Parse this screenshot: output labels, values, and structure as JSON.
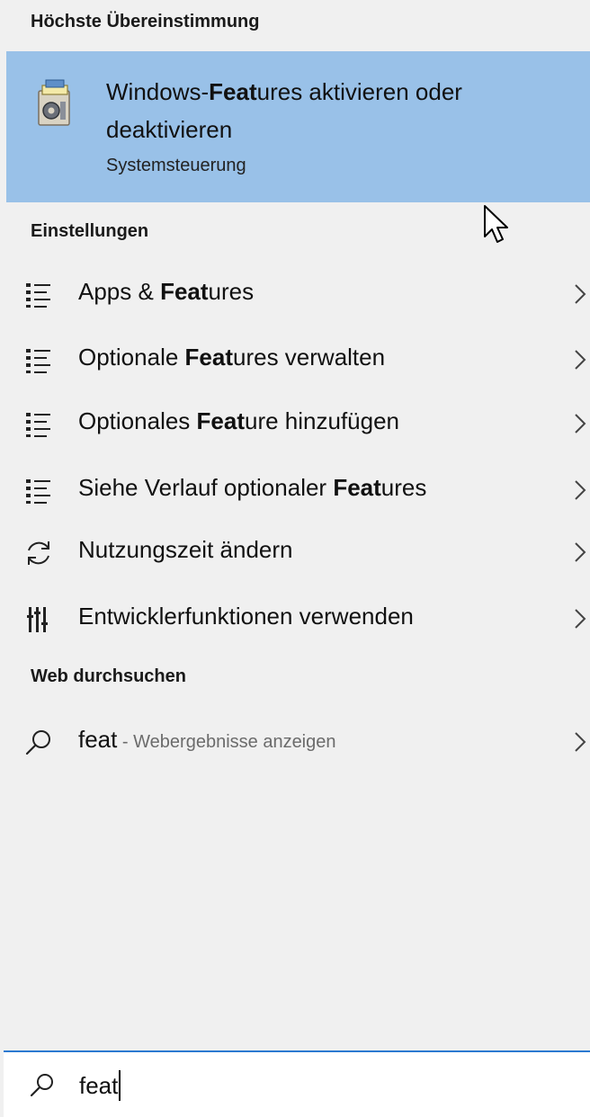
{
  "sections": {
    "best_match": "Höchste Übereinstimmung",
    "settings": "Einstellungen",
    "web": "Web durchsuchen"
  },
  "best_match": {
    "title_before": "Windows-",
    "title_bold": "Feat",
    "title_after": "ures aktivieren oder deaktivieren",
    "subtitle": "Systemsteuerung",
    "icon": "windows-features-icon",
    "highlight_color": "#99c1e8"
  },
  "settings_items": [
    {
      "icon": "list-settings-icon",
      "pre": "Apps & ",
      "bold": "Feat",
      "post": "ures"
    },
    {
      "icon": "list-settings-icon",
      "pre": "Optionale ",
      "bold": "Feat",
      "post": "ures verwalten"
    },
    {
      "icon": "list-settings-icon",
      "pre": "Optionales ",
      "bold": "Feat",
      "post": "ure hinzufügen"
    },
    {
      "icon": "list-settings-icon",
      "pre": "Siehe Verlauf optionaler ",
      "bold": "Feat",
      "post": "ures"
    },
    {
      "icon": "sync-icon",
      "pre": "Nutzungszeit ändern",
      "bold": "",
      "post": ""
    },
    {
      "icon": "developer-tools-icon",
      "pre": "Entwicklerfunktionen verwenden",
      "bold": "",
      "post": ""
    }
  ],
  "web_item": {
    "icon": "search-icon",
    "query": "feat",
    "separator": " - ",
    "hint": "Webergebnisse anzeigen"
  },
  "search": {
    "icon": "search-icon",
    "value": "feat",
    "accent_color": "#2b79d0"
  }
}
